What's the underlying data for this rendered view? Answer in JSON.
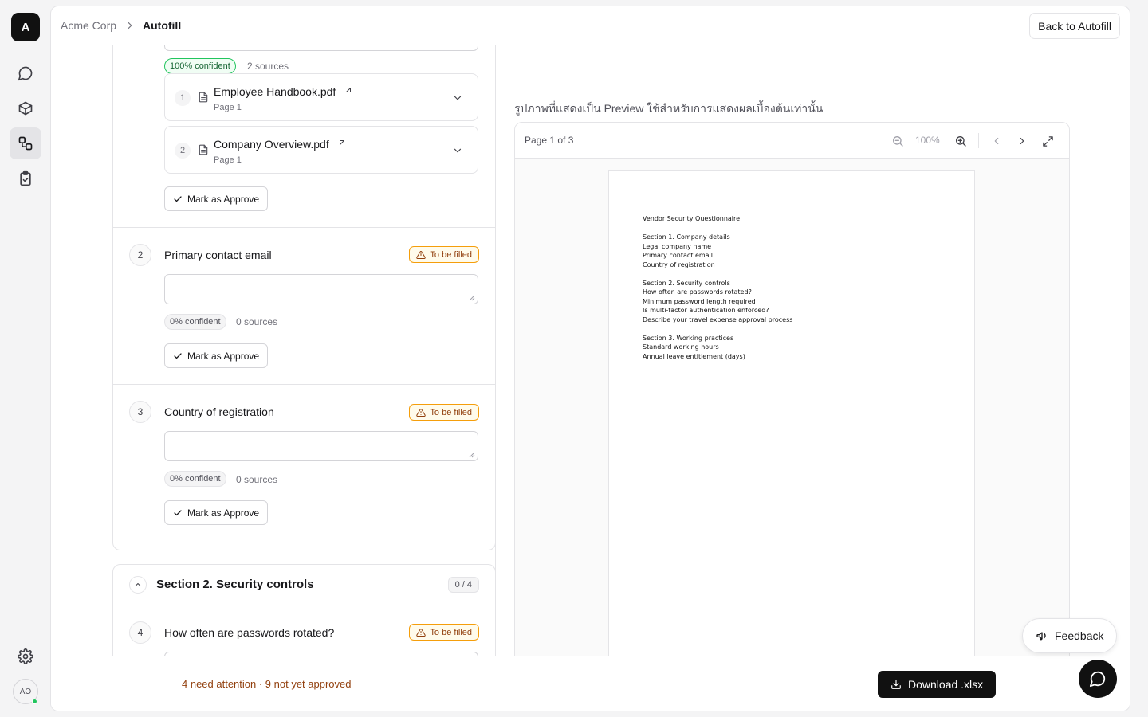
{
  "app": {
    "logo_letter": "A"
  },
  "breadcrumb": {
    "org": "Acme Corp",
    "page": "Autofill"
  },
  "header": {
    "back_label": "Back to Autofill"
  },
  "user": {
    "initials": "AO"
  },
  "question1": {
    "confidence": "100% confident",
    "sources_count": "2 sources",
    "sources": [
      {
        "num": "1",
        "name": "Employee Handbook.pdf",
        "page": "Page 1"
      },
      {
        "num": "2",
        "name": "Company Overview.pdf",
        "page": "Page 1"
      }
    ],
    "approve_label": "Mark as Approve"
  },
  "questions": [
    {
      "num": "2",
      "text": "Primary contact email",
      "status": "To be filled",
      "answer": "",
      "confidence": "0% confident",
      "sources_count": "0 sources",
      "approve_label": "Mark as Approve"
    },
    {
      "num": "3",
      "text": "Country of registration",
      "status": "To be filled",
      "answer": "",
      "confidence": "0% confident",
      "sources_count": "0 sources",
      "approve_label": "Mark as Approve"
    }
  ],
  "section2": {
    "title": "Section 2. Security controls",
    "count": "0 / 4",
    "first_question": {
      "num": "4",
      "text": "How often are passwords rotated?",
      "status": "To be filled"
    }
  },
  "preview": {
    "note": "รูปภาพที่แสดงเป็น Preview ใช้สำหรับการแสดงผลเบื้องต้นเท่านั้น",
    "page_indicator": "Page 1 of 3",
    "zoom": "100%",
    "document_lines": [
      "Vendor Security Questionnaire",
      "",
      "Section 1. Company details",
      "Legal company name",
      "Primary contact email",
      "Country of registration",
      "",
      "Section 2. Security controls",
      "How often are passwords rotated?",
      "Minimum password length required",
      "Is multi-factor authentication enforced?",
      "Describe your travel expense approval process",
      "",
      "Section 3. Working practices",
      "Standard working hours",
      "Annual leave entitlement (days)"
    ]
  },
  "footer": {
    "attention": "4 need attention · 9 not yet approved",
    "download_label": "Download .xlsx"
  },
  "feedback_label": "Feedback",
  "colors": {
    "accent": "#111111",
    "warning": "#f59e0b",
    "success": "#22c55e"
  }
}
